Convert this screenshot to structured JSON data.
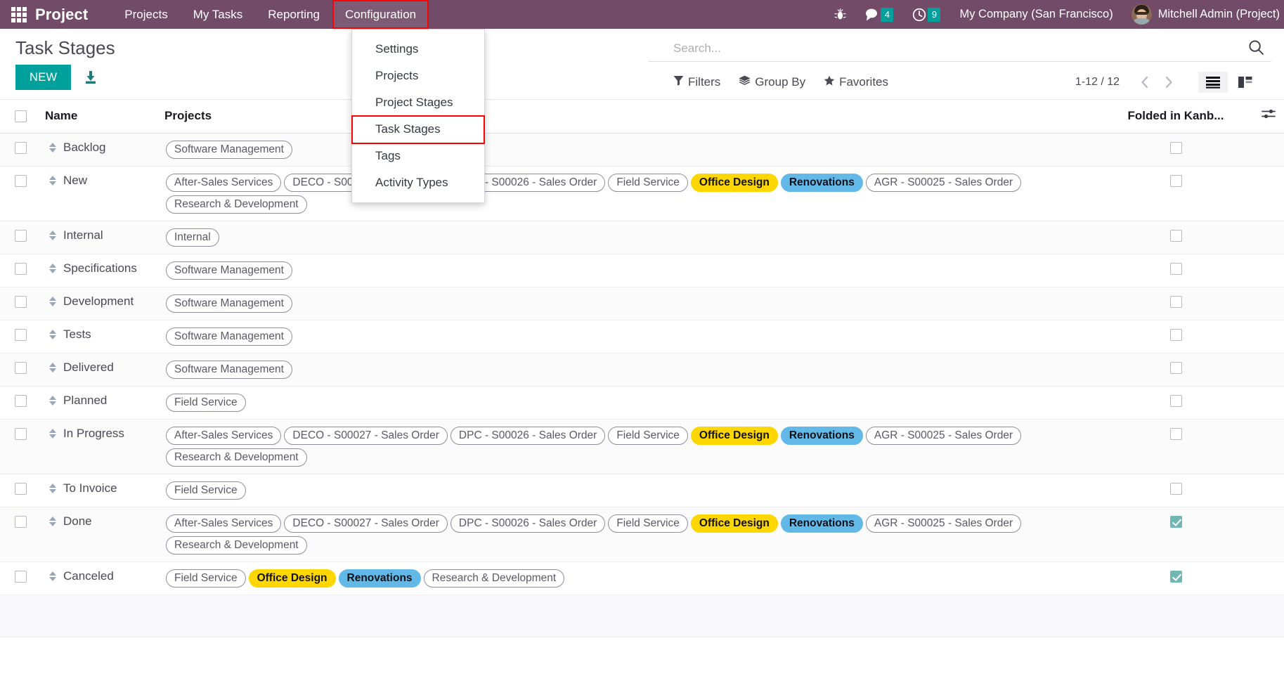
{
  "navbar": {
    "apps_icon": "apps-grid-icon",
    "brand": "Project",
    "menus": [
      {
        "label": "Projects",
        "active": false
      },
      {
        "label": "My Tasks",
        "active": false
      },
      {
        "label": "Reporting",
        "active": false
      },
      {
        "label": "Configuration",
        "active": true
      }
    ],
    "debug_icon": "bug-icon",
    "messages": {
      "icon": "chat-bubble-icon",
      "count": "4"
    },
    "activities": {
      "icon": "clock-icon",
      "count": "9"
    },
    "company": "My Company (San Francisco)",
    "user": "Mitchell Admin (Project)",
    "avatar_icon": "user-avatar",
    "bg_color": "#714B67",
    "counter_color": "#00A09D"
  },
  "dropdown": {
    "items": [
      {
        "label": "Settings",
        "highlighted": false
      },
      {
        "label": "Projects",
        "highlighted": false
      },
      {
        "label": "Project Stages",
        "highlighted": false
      },
      {
        "label": "Task Stages",
        "highlighted": true
      },
      {
        "label": "Tags",
        "highlighted": false
      },
      {
        "label": "Activity Types",
        "highlighted": false
      }
    ]
  },
  "control_panel": {
    "title": "Task Stages",
    "new_label": "NEW",
    "export_icon": "download-icon",
    "search": {
      "placeholder": "Search...",
      "value": "",
      "icon": "search-icon"
    },
    "filters": [
      {
        "label": "Filters",
        "icon": "filter-icon"
      },
      {
        "label": "Group By",
        "icon": "layers-icon"
      },
      {
        "label": "Favorites",
        "icon": "star-icon"
      }
    ],
    "pager": "1-12 / 12",
    "prev_icon": "chevron-left-icon",
    "next_icon": "chevron-right-icon",
    "views": [
      {
        "name": "list-view",
        "icon": "list-icon",
        "active": true
      },
      {
        "name": "kanban-view",
        "icon": "kanban-icon",
        "active": false
      }
    ]
  },
  "table": {
    "columns": [
      "",
      "Name",
      "Projects",
      "Folded in Kanb...",
      ""
    ],
    "optional_columns_icon": "sliders-icon",
    "select_all_checked": false,
    "rows": [
      {
        "name": "Backlog",
        "checked": false,
        "folded": false,
        "tags": [
          {
            "label": "Software Management",
            "style": "plain"
          }
        ]
      },
      {
        "name": "New",
        "checked": false,
        "folded": false,
        "tags": [
          {
            "label": "After-Sales Services",
            "style": "plain"
          },
          {
            "label": "DECO - S00027 - Sales Order",
            "style": "plain"
          },
          {
            "label": "DPC - S00026 - Sales Order",
            "style": "plain"
          },
          {
            "label": "Field Service",
            "style": "plain"
          },
          {
            "label": "Office Design",
            "style": "yellow"
          },
          {
            "label": "Renovations",
            "style": "blue"
          },
          {
            "label": "AGR - S00025 - Sales Order",
            "style": "plain"
          },
          {
            "label": "Research & Development",
            "style": "plain"
          }
        ]
      },
      {
        "name": "Internal",
        "checked": false,
        "folded": false,
        "tags": [
          {
            "label": "Internal",
            "style": "plain"
          }
        ]
      },
      {
        "name": "Specifications",
        "checked": false,
        "folded": false,
        "tags": [
          {
            "label": "Software Management",
            "style": "plain"
          }
        ]
      },
      {
        "name": "Development",
        "checked": false,
        "folded": false,
        "tags": [
          {
            "label": "Software Management",
            "style": "plain"
          }
        ]
      },
      {
        "name": "Tests",
        "checked": false,
        "folded": false,
        "tags": [
          {
            "label": "Software Management",
            "style": "plain"
          }
        ]
      },
      {
        "name": "Delivered",
        "checked": false,
        "folded": false,
        "tags": [
          {
            "label": "Software Management",
            "style": "plain"
          }
        ]
      },
      {
        "name": "Planned",
        "checked": false,
        "folded": false,
        "tags": [
          {
            "label": "Field Service",
            "style": "plain"
          }
        ]
      },
      {
        "name": "In Progress",
        "checked": false,
        "folded": false,
        "tags": [
          {
            "label": "After-Sales Services",
            "style": "plain"
          },
          {
            "label": "DECO - S00027 - Sales Order",
            "style": "plain"
          },
          {
            "label": "DPC - S00026 - Sales Order",
            "style": "plain"
          },
          {
            "label": "Field Service",
            "style": "plain"
          },
          {
            "label": "Office Design",
            "style": "yellow"
          },
          {
            "label": "Renovations",
            "style": "blue"
          },
          {
            "label": "AGR - S00025 - Sales Order",
            "style": "plain"
          },
          {
            "label": "Research & Development",
            "style": "plain"
          }
        ]
      },
      {
        "name": "To Invoice",
        "checked": false,
        "folded": false,
        "tags": [
          {
            "label": "Field Service",
            "style": "plain"
          }
        ]
      },
      {
        "name": "Done",
        "checked": false,
        "folded": true,
        "tags": [
          {
            "label": "After-Sales Services",
            "style": "plain"
          },
          {
            "label": "DECO - S00027 - Sales Order",
            "style": "plain"
          },
          {
            "label": "DPC - S00026 - Sales Order",
            "style": "plain"
          },
          {
            "label": "Field Service",
            "style": "plain"
          },
          {
            "label": "Office Design",
            "style": "yellow"
          },
          {
            "label": "Renovations",
            "style": "blue"
          },
          {
            "label": "AGR - S00025 - Sales Order",
            "style": "plain"
          },
          {
            "label": "Research & Development",
            "style": "plain"
          }
        ]
      },
      {
        "name": "Canceled",
        "checked": false,
        "folded": true,
        "tags": [
          {
            "label": "Field Service",
            "style": "plain"
          },
          {
            "label": "Office Design",
            "style": "yellow"
          },
          {
            "label": "Renovations",
            "style": "blue"
          },
          {
            "label": "Research & Development",
            "style": "plain"
          }
        ]
      }
    ]
  }
}
